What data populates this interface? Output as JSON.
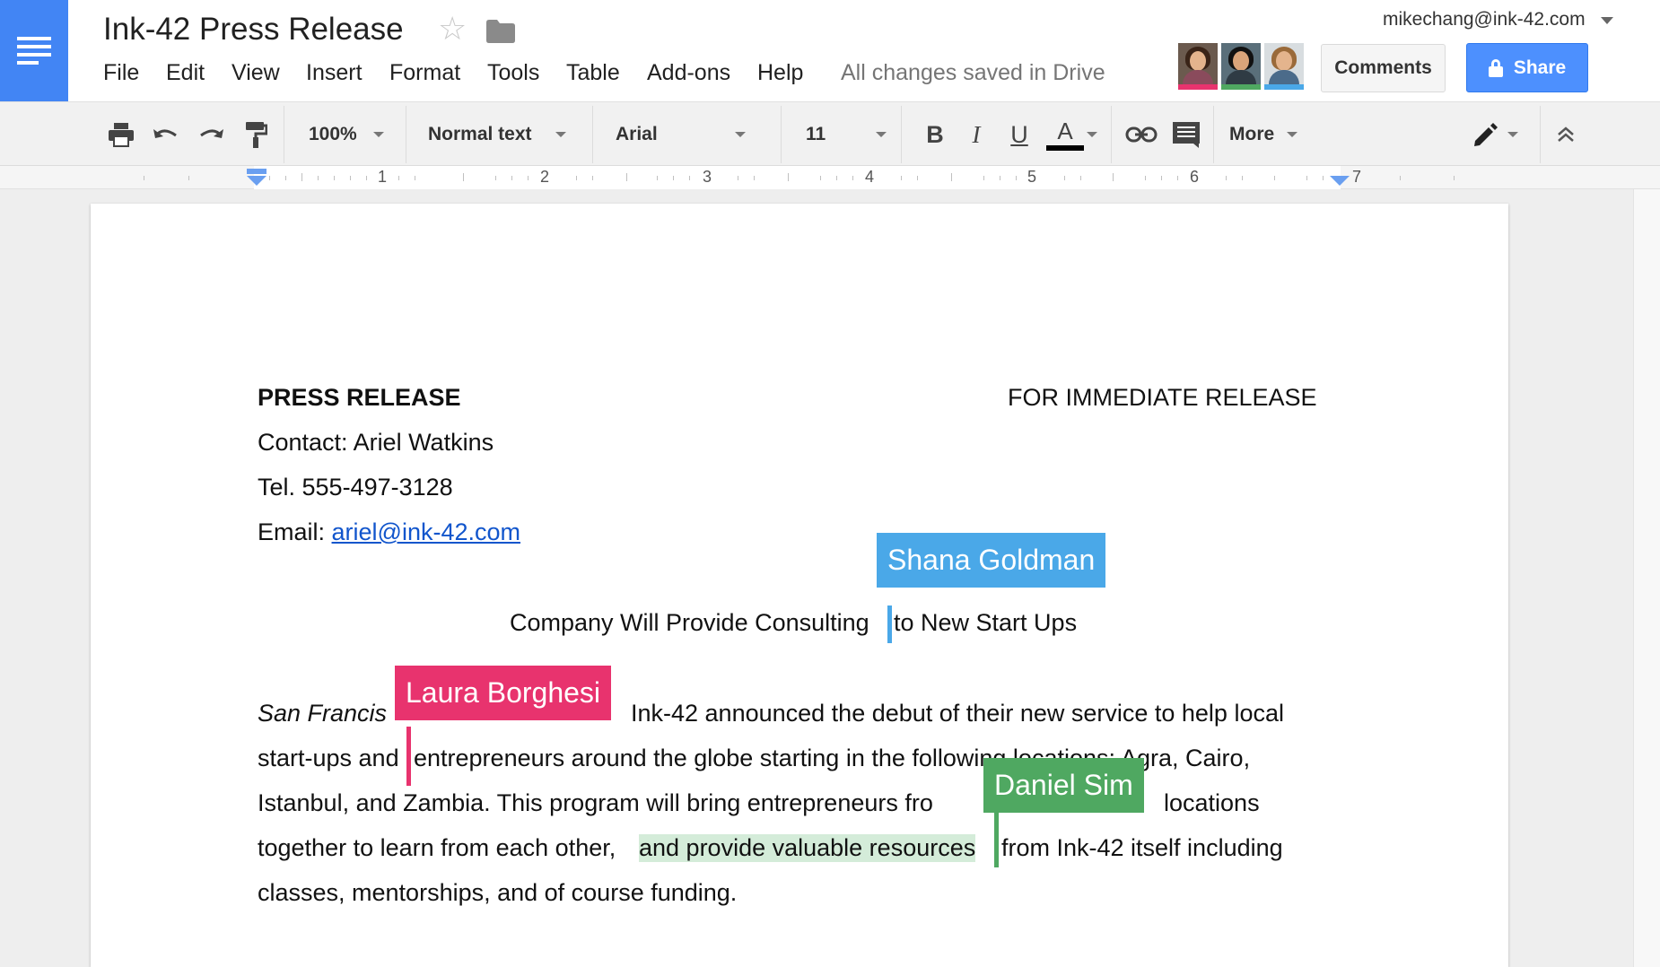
{
  "doc": {
    "title": "Ink-42 Press Release",
    "save_status": "All changes saved in Drive"
  },
  "menu": [
    "File",
    "Edit",
    "View",
    "Insert",
    "Format",
    "Tools",
    "Table",
    "Add-ons",
    "Help"
  ],
  "account": {
    "email": "mikechang@ink-42.com"
  },
  "buttons": {
    "comments": "Comments",
    "share": "Share"
  },
  "collaborator_colors": {
    "shana": "#4aa8e8",
    "laura": "#e8336e",
    "daniel": "#4fa861"
  },
  "toolbar": {
    "zoom": "100%",
    "style": "Normal text",
    "font": "Arial",
    "size": "11",
    "bold": "B",
    "italic": "I",
    "underline": "U",
    "text_color": "A",
    "more": "More"
  },
  "ruler": {
    "numbers": [
      "1",
      "2",
      "3",
      "4",
      "5",
      "6",
      "7"
    ]
  },
  "content": {
    "header_left": "PRESS RELEASE",
    "header_right": "FOR IMMEDIATE RELEASE",
    "contact": "Contact: Ariel Watkins",
    "tel": "Tel. 555-497-3128",
    "email_label": "Email: ",
    "email_link": "ariel@ink-42.com",
    "headline_a": "Company Will Provide Consulting",
    "headline_b": "to New Start Ups",
    "p1_a": "San Francis",
    "p1_b": "Ink-42 announced the debut of their new service to help local",
    "p2_a": "start-ups and",
    "p2_b": "entrepreneurs around the globe starting in the following locations: Agra, Cairo,",
    "p3_a": "Istanbul, and Zambia. This program will bring entrepreneurs fro",
    "p3_b": "locations",
    "p4_a": "together to learn from each other, ",
    "p4_hl": "and provide valuable resources",
    "p4_b": "from Ink-42 itself including",
    "p5": "classes, mentorships, and of course funding."
  },
  "collaborators": {
    "shana": "Shana Goldman",
    "laura": "Laura Borghesi",
    "daniel": "Daniel Sim"
  }
}
